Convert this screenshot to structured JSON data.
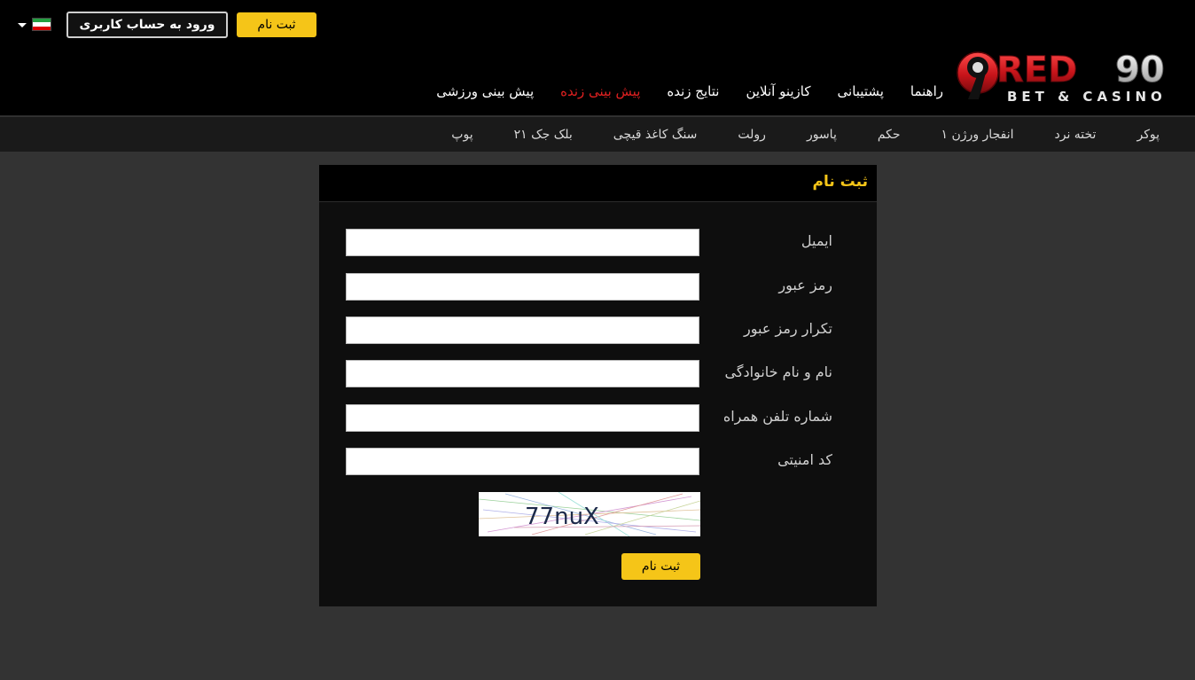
{
  "header": {
    "login_label": "ورود به حساب کاربری",
    "signup_label": "ثبت نام",
    "language_flag": "iran-flag-icon",
    "logo_text": "RED90",
    "logo_subtitle": "BET & CASINO",
    "nav": [
      {
        "label": "پیش بینی ورزشی",
        "active": false
      },
      {
        "label": "پیش بینی زنده",
        "active": true
      },
      {
        "label": "نتایج زنده",
        "active": false
      },
      {
        "label": "کازینو آنلاین",
        "active": false
      },
      {
        "label": "پشتیبانی",
        "active": false
      },
      {
        "label": "راهنما",
        "active": false
      }
    ]
  },
  "subnav": [
    {
      "label": "پوکر"
    },
    {
      "label": "تخته نرد"
    },
    {
      "label": "انفجار ورژن ۱"
    },
    {
      "label": "حکم"
    },
    {
      "label": "پاسور"
    },
    {
      "label": "رولت"
    },
    {
      "label": "سنگ کاغذ قیچی"
    },
    {
      "label": "بلک جک ۲۱"
    },
    {
      "label": "پوپ"
    }
  ],
  "form": {
    "title": "ثبت نام",
    "fields": [
      {
        "label": "ایمیل",
        "value": ""
      },
      {
        "label": "رمز عبور",
        "value": ""
      },
      {
        "label": "تکرار رمز عبور",
        "value": ""
      },
      {
        "label": "نام و نام خانوادگی",
        "value": ""
      },
      {
        "label": "شماره تلفن همراه",
        "value": ""
      },
      {
        "label": "کد امنیتی",
        "value": ""
      }
    ],
    "captcha_text": "77nuX",
    "submit_label": "ثبت نام"
  },
  "colors": {
    "accent": "#f5c518",
    "active_nav": "#e02020",
    "background": "#333333",
    "header_bg": "#000000"
  }
}
